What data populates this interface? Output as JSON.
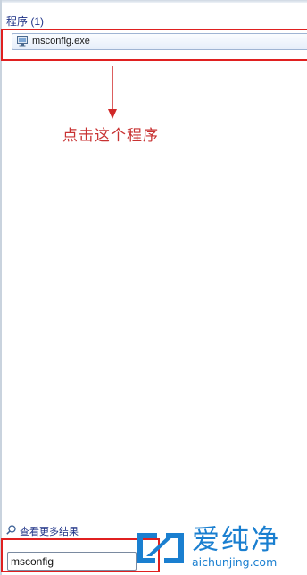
{
  "results": {
    "header": "程序 (1)",
    "items": [
      {
        "label": "msconfig.exe",
        "icon": "system-config-icon"
      }
    ]
  },
  "annotation": {
    "text": "点击这个程序",
    "color": "#c83232"
  },
  "footer": {
    "see_more_label": "查看更多结果",
    "search_value": "msconfig"
  },
  "watermark": {
    "brand": "爱纯净",
    "url": "aichunjing.com",
    "color": "#1a7fd0"
  },
  "highlight_color": "#e02020"
}
